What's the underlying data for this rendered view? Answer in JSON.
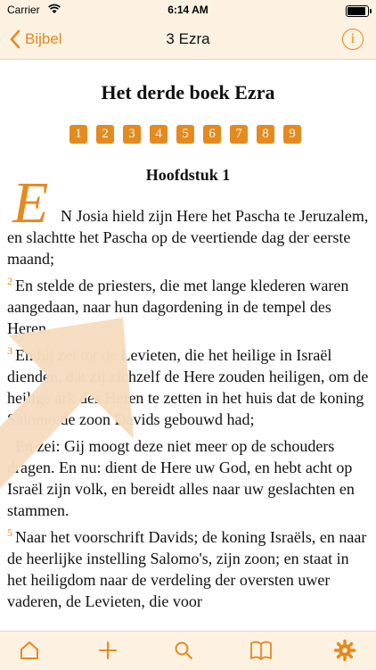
{
  "status_bar": {
    "carrier": "Carrier",
    "time": "6:14 AM"
  },
  "nav": {
    "back_label": "Bijbel",
    "title": "3 Ezra",
    "info_label": "i"
  },
  "book": {
    "title": "Het derde boek Ezra",
    "chapters": [
      "1",
      "2",
      "3",
      "4",
      "5",
      "6",
      "7",
      "8",
      "9"
    ],
    "chapter_heading": "Hoofdstuk 1",
    "drop_cap": "E",
    "verses": [
      {
        "num": "",
        "text": "N Josia hield zijn Here het Pascha te Jeruzalem, en slachtte het Pascha op de veertiende dag der eerste maand;"
      },
      {
        "num": "2",
        "text": "En stelde de priesters, die met lange klederen waren aangedaan, naar hun dagordening in de tempel des Heren."
      },
      {
        "num": "3",
        "text": "En hij zei tot de Levieten, die het heilige in Israël dienden, dat zij zichzelf de Here zouden heiligen, om de heilige ark des Heren te zetten in het huis dat de koning Salomo de zoon Davids gebouwd had;"
      },
      {
        "num": "4",
        "text": "En zei: Gij moogt deze niet meer op de schouders dragen. En nu: dient de Here uw God, en hebt acht op Israël zijn volk, en bereidt alles naar uw geslachten en stammen."
      },
      {
        "num": "5",
        "text": "Naar het voorschrift Davids; de koning Israëls, en naar de heerlijke instelling Salomo's, zijn zoon; en staat in het heiligdom naar de verdeling der oversten uwer vaderen, de Levieten, die voor"
      }
    ]
  },
  "tabs": [
    {
      "icon": "home-icon"
    },
    {
      "icon": "plus-icon"
    },
    {
      "icon": "search-icon"
    },
    {
      "icon": "book-icon"
    },
    {
      "icon": "gear-icon"
    }
  ],
  "colors": {
    "accent": "#e58a1f",
    "bar_bg": "#fdf1e2",
    "overlay": "#f6dcc0"
  }
}
